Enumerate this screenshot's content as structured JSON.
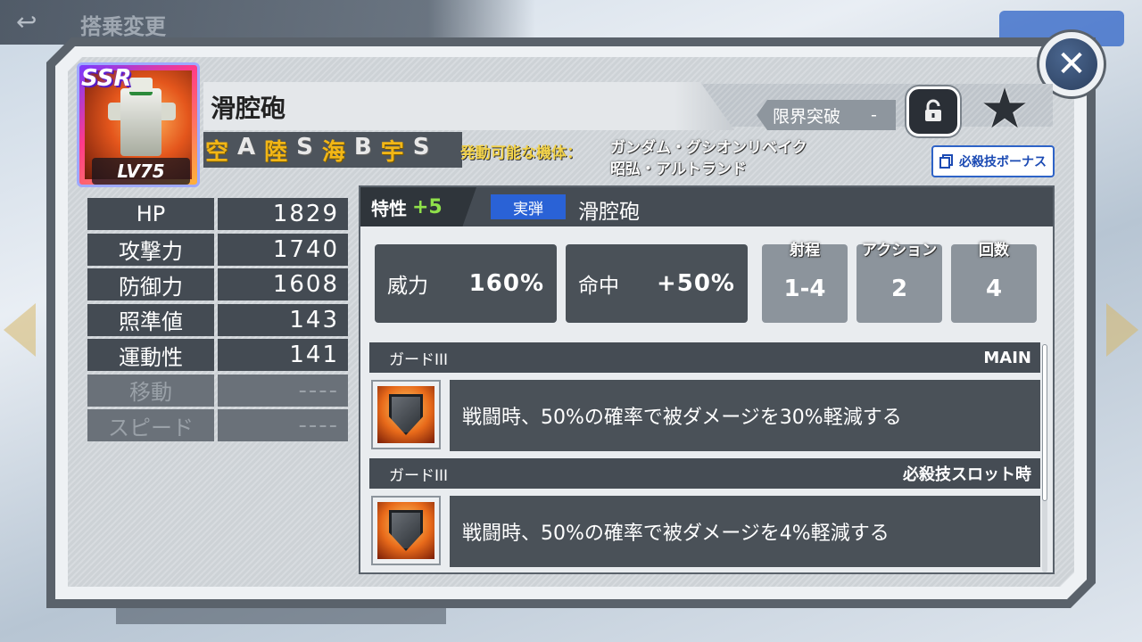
{
  "background": {
    "title": "搭乗変更"
  },
  "unit": {
    "rarity": "SSR",
    "level": "LV75",
    "name": "滑腔砲",
    "terrain": [
      {
        "k": "空",
        "v": "A"
      },
      {
        "k": "陸",
        "v": "S"
      },
      {
        "k": "海",
        "v": "B"
      },
      {
        "k": "宇",
        "v": "S"
      }
    ],
    "usable_label": "発動可能な機体：",
    "usable_units": [
      "ガンダム・グシオンリベイク",
      "昭弘・アルトランド"
    ],
    "limit_break_label": "限界突破",
    "limit_break_value": "-",
    "bonus_button": "必殺技ボーナス"
  },
  "stats": [
    {
      "label": "HP",
      "value": "1829",
      "dim": false
    },
    {
      "label": "攻撃力",
      "value": "1740",
      "dim": false
    },
    {
      "label": "防御力",
      "value": "1608",
      "dim": false
    },
    {
      "label": "照準値",
      "value": "143",
      "dim": false
    },
    {
      "label": "運動性",
      "value": "141",
      "dim": false
    },
    {
      "label": "移動",
      "value": "----",
      "dim": true
    },
    {
      "label": "スピード",
      "value": "----",
      "dim": true
    }
  ],
  "weapon": {
    "trait_label": "特性",
    "trait_value": "+5",
    "ammo_type": "実弾",
    "name": "滑腔砲",
    "power_label": "威力",
    "power_value": "160%",
    "accuracy_label": "命中",
    "accuracy_value": "+50%",
    "range_label": "射程",
    "range_value": "1-4",
    "action_label": "アクション",
    "action_value": "2",
    "count_label": "回数",
    "count_value": "4"
  },
  "skills": [
    {
      "name": "ガードIII",
      "tag": "MAIN",
      "description": "戦闘時、50%の確率で被ダメージを30%軽減する"
    },
    {
      "name": "ガードIII",
      "tag": "必殺技スロット時",
      "description": "戦闘時、50%の確率で被ダメージを4%軽減する"
    }
  ],
  "colors": {
    "accent_blue": "#2a62d6",
    "terrain_gold": "#f2b616",
    "trait_green": "#8fe04a",
    "panel_dark": "#4a5158"
  }
}
